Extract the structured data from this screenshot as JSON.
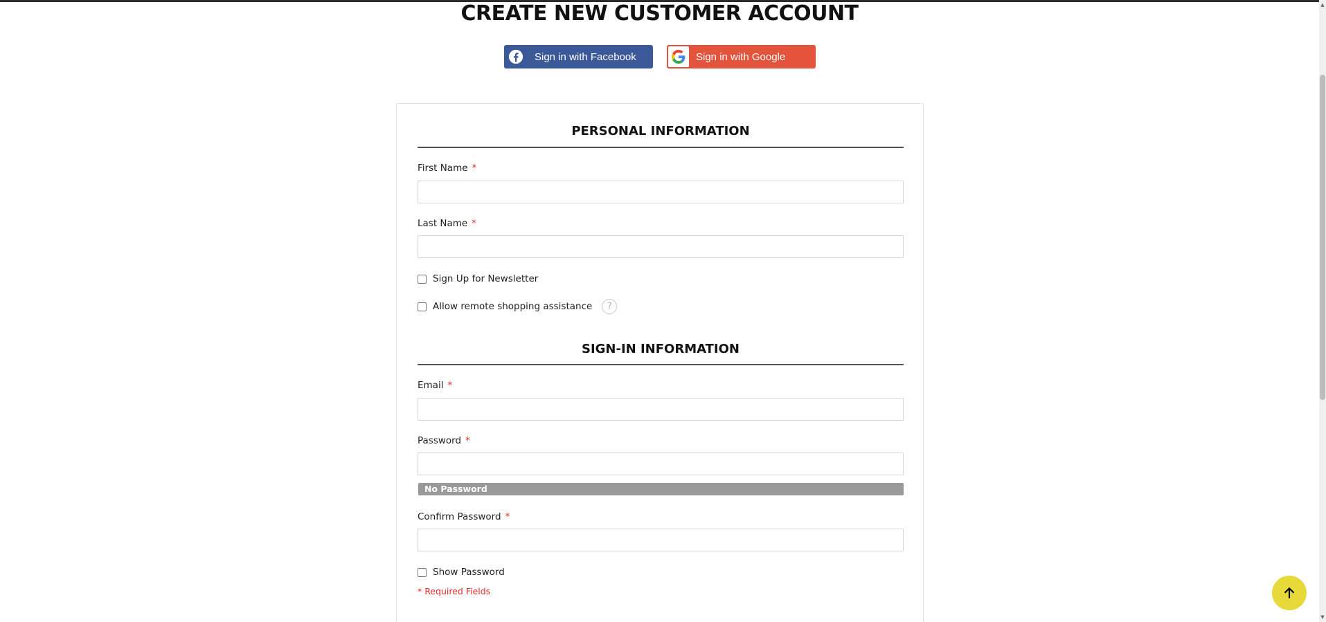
{
  "page": {
    "title": "CREATE NEW CUSTOMER ACCOUNT"
  },
  "social": {
    "facebook_label": "Sign in with Facebook",
    "google_label": "Sign in with Google",
    "facebook_color": "#3b5998",
    "google_color": "#e4533b"
  },
  "personal": {
    "heading": "PERSONAL INFORMATION",
    "first_name_label": "First Name",
    "first_name_value": "",
    "last_name_label": "Last Name",
    "last_name_value": "",
    "newsletter_label": "Sign Up for Newsletter",
    "newsletter_checked": false,
    "assistance_label": "Allow remote shopping assistance",
    "assistance_checked": false,
    "help_icon": "question-circle-icon"
  },
  "signin": {
    "heading": "SIGN-IN INFORMATION",
    "email_label": "Email",
    "email_value": "",
    "password_label": "Password",
    "password_value": "",
    "password_strength": "No Password",
    "confirm_label": "Confirm Password",
    "confirm_value": "",
    "show_password_label": "Show Password",
    "show_password_checked": false
  },
  "required_marker": "*",
  "required_note": "* Required Fields",
  "back_to_top_icon": "arrow-up-icon",
  "accent_color": "#e8d93a",
  "required_color": "#e02b27"
}
